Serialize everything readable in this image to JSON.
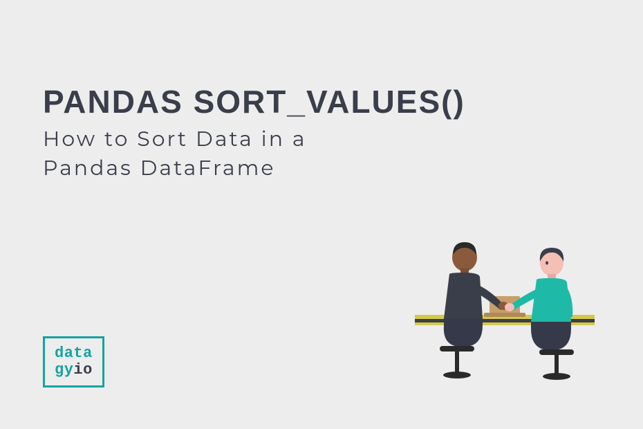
{
  "title": "pandas sort_values()",
  "subtitle": "How to Sort Data in a Pandas DataFrame",
  "logo": {
    "line1": "data",
    "line2_part1": "gy",
    "line2_part2": "io"
  },
  "colors": {
    "accent": "#14a3a1",
    "text": "#3a3e4a",
    "background": "#ededed",
    "skin1": "#8b5a3c",
    "skin2": "#f4bfb5",
    "shirt1": "#3a3e4a",
    "shirt2": "#1fb9a8",
    "pants": "#36394a",
    "laptop": "#c89f6b",
    "table": "#c4c0c0",
    "tableEdge": "#d4c94a"
  }
}
